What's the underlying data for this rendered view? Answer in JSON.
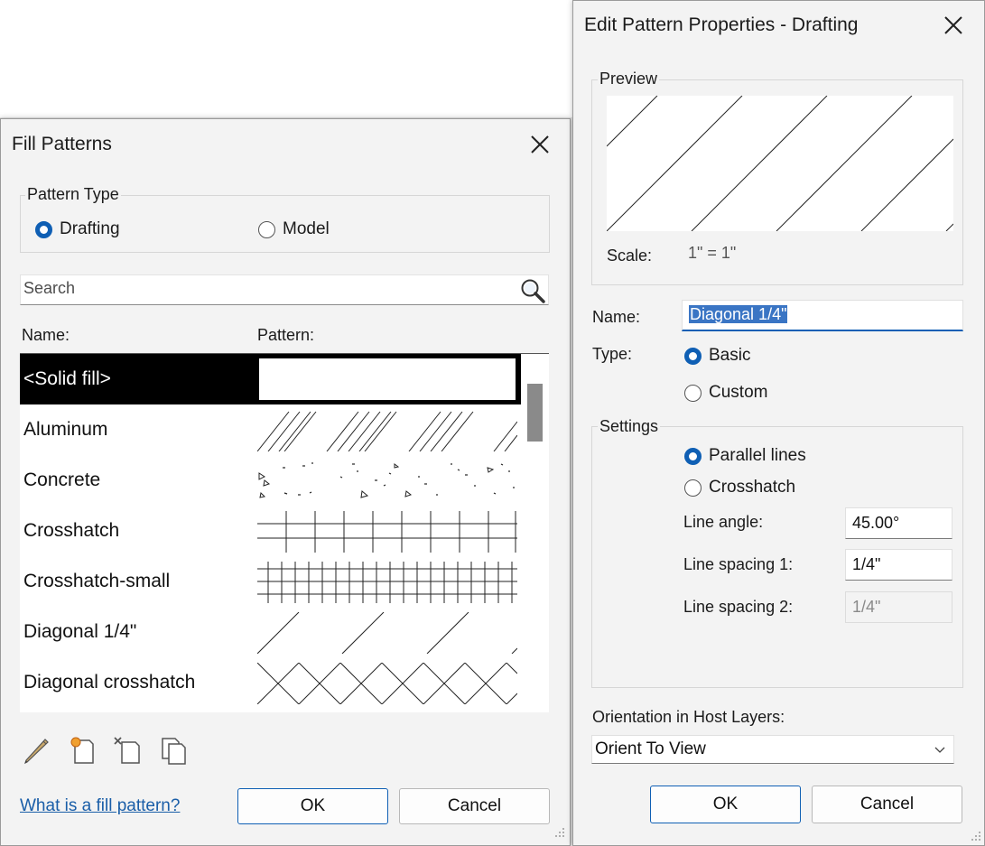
{
  "fill_patterns": {
    "title": "Fill Patterns",
    "pattern_type": {
      "label": "Pattern Type",
      "options": [
        "Drafting",
        "Model"
      ],
      "selected": "Drafting"
    },
    "search": {
      "placeholder": "Search"
    },
    "columns": {
      "name": "Name:",
      "pattern": "Pattern:"
    },
    "rows": [
      {
        "name": "<Solid fill>",
        "pattern": "solid",
        "selected": true
      },
      {
        "name": "Aluminum",
        "pattern": "aluminum"
      },
      {
        "name": "Concrete",
        "pattern": "concrete"
      },
      {
        "name": "Crosshatch",
        "pattern": "crosshatch"
      },
      {
        "name": "Crosshatch-small",
        "pattern": "crosshatch-small"
      },
      {
        "name": "Diagonal 1/4\"",
        "pattern": "diagonal"
      },
      {
        "name": "Diagonal crosshatch",
        "pattern": "diagonal-crosshatch"
      }
    ],
    "toolbar_icons": [
      "edit-pencil-icon",
      "new-pattern-icon",
      "delete-pattern-icon",
      "duplicate-pattern-icon"
    ],
    "help_link": "What is a fill pattern?",
    "ok_label": "OK",
    "cancel_label": "Cancel"
  },
  "edit_pattern": {
    "title": "Edit Pattern Properties - Drafting",
    "preview_label": "Preview",
    "scale_label": "Scale:",
    "scale_value": "1\" = 1\"",
    "name_label": "Name:",
    "name_value": "Diagonal 1/4\"",
    "type_label": "Type:",
    "type_options": [
      "Basic",
      "Custom"
    ],
    "type_selected": "Basic",
    "settings_label": "Settings",
    "settings_options": [
      "Parallel lines",
      "Crosshatch"
    ],
    "settings_selected": "Parallel lines",
    "line_angle_label": "Line angle:",
    "line_angle_value": "45.00°",
    "line_spacing1_label": "Line spacing 1:",
    "line_spacing1_value": "1/4\"",
    "line_spacing2_label": "Line spacing 2:",
    "line_spacing2_value": "1/4\"",
    "orientation_label": "Orientation in Host Layers:",
    "orientation_value": "Orient To View",
    "ok_label": "OK",
    "cancel_label": "Cancel"
  },
  "colors": {
    "accent": "#0f5fb4",
    "selection": "#000000",
    "link": "#1a5ea8",
    "dialog_bg": "#f3f3f3"
  }
}
